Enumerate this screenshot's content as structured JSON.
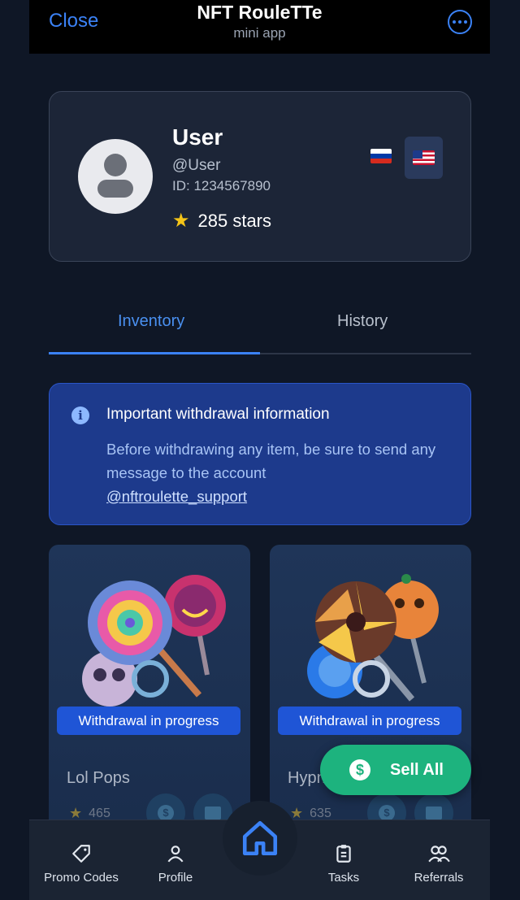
{
  "topbar": {
    "close_label": "Close",
    "title": "NFT RouleTTe",
    "subtitle": "mini app",
    "more_icon": "more-dots-icon"
  },
  "profile": {
    "name": "User",
    "handle": "@User",
    "id_text": "ID: 1234567890",
    "stars": "285 stars",
    "languages": [
      "ru",
      "us"
    ],
    "active_language": "us"
  },
  "tabs": [
    {
      "label": "Inventory",
      "active": true
    },
    {
      "label": "History",
      "active": false
    }
  ],
  "info": {
    "title": "Important withdrawal information",
    "text": "Before withdrawing any item, be sure to send any message to the account",
    "link": "@nftroulette_support"
  },
  "items": [
    {
      "name": "Lol Pops",
      "price": "465",
      "status": "Withdrawal in progress"
    },
    {
      "name": "Hypn",
      "price": "635",
      "status": "Withdrawal in progress"
    }
  ],
  "sell_all_label": "Sell All",
  "nav": {
    "promo": "Promo Codes",
    "profile": "Profile",
    "tasks": "Tasks",
    "referrals": "Referrals"
  },
  "colors": {
    "accent": "#3b82f6",
    "background": "#0f1726",
    "success": "#1db37e",
    "info_bg": "#1d3a8c"
  }
}
